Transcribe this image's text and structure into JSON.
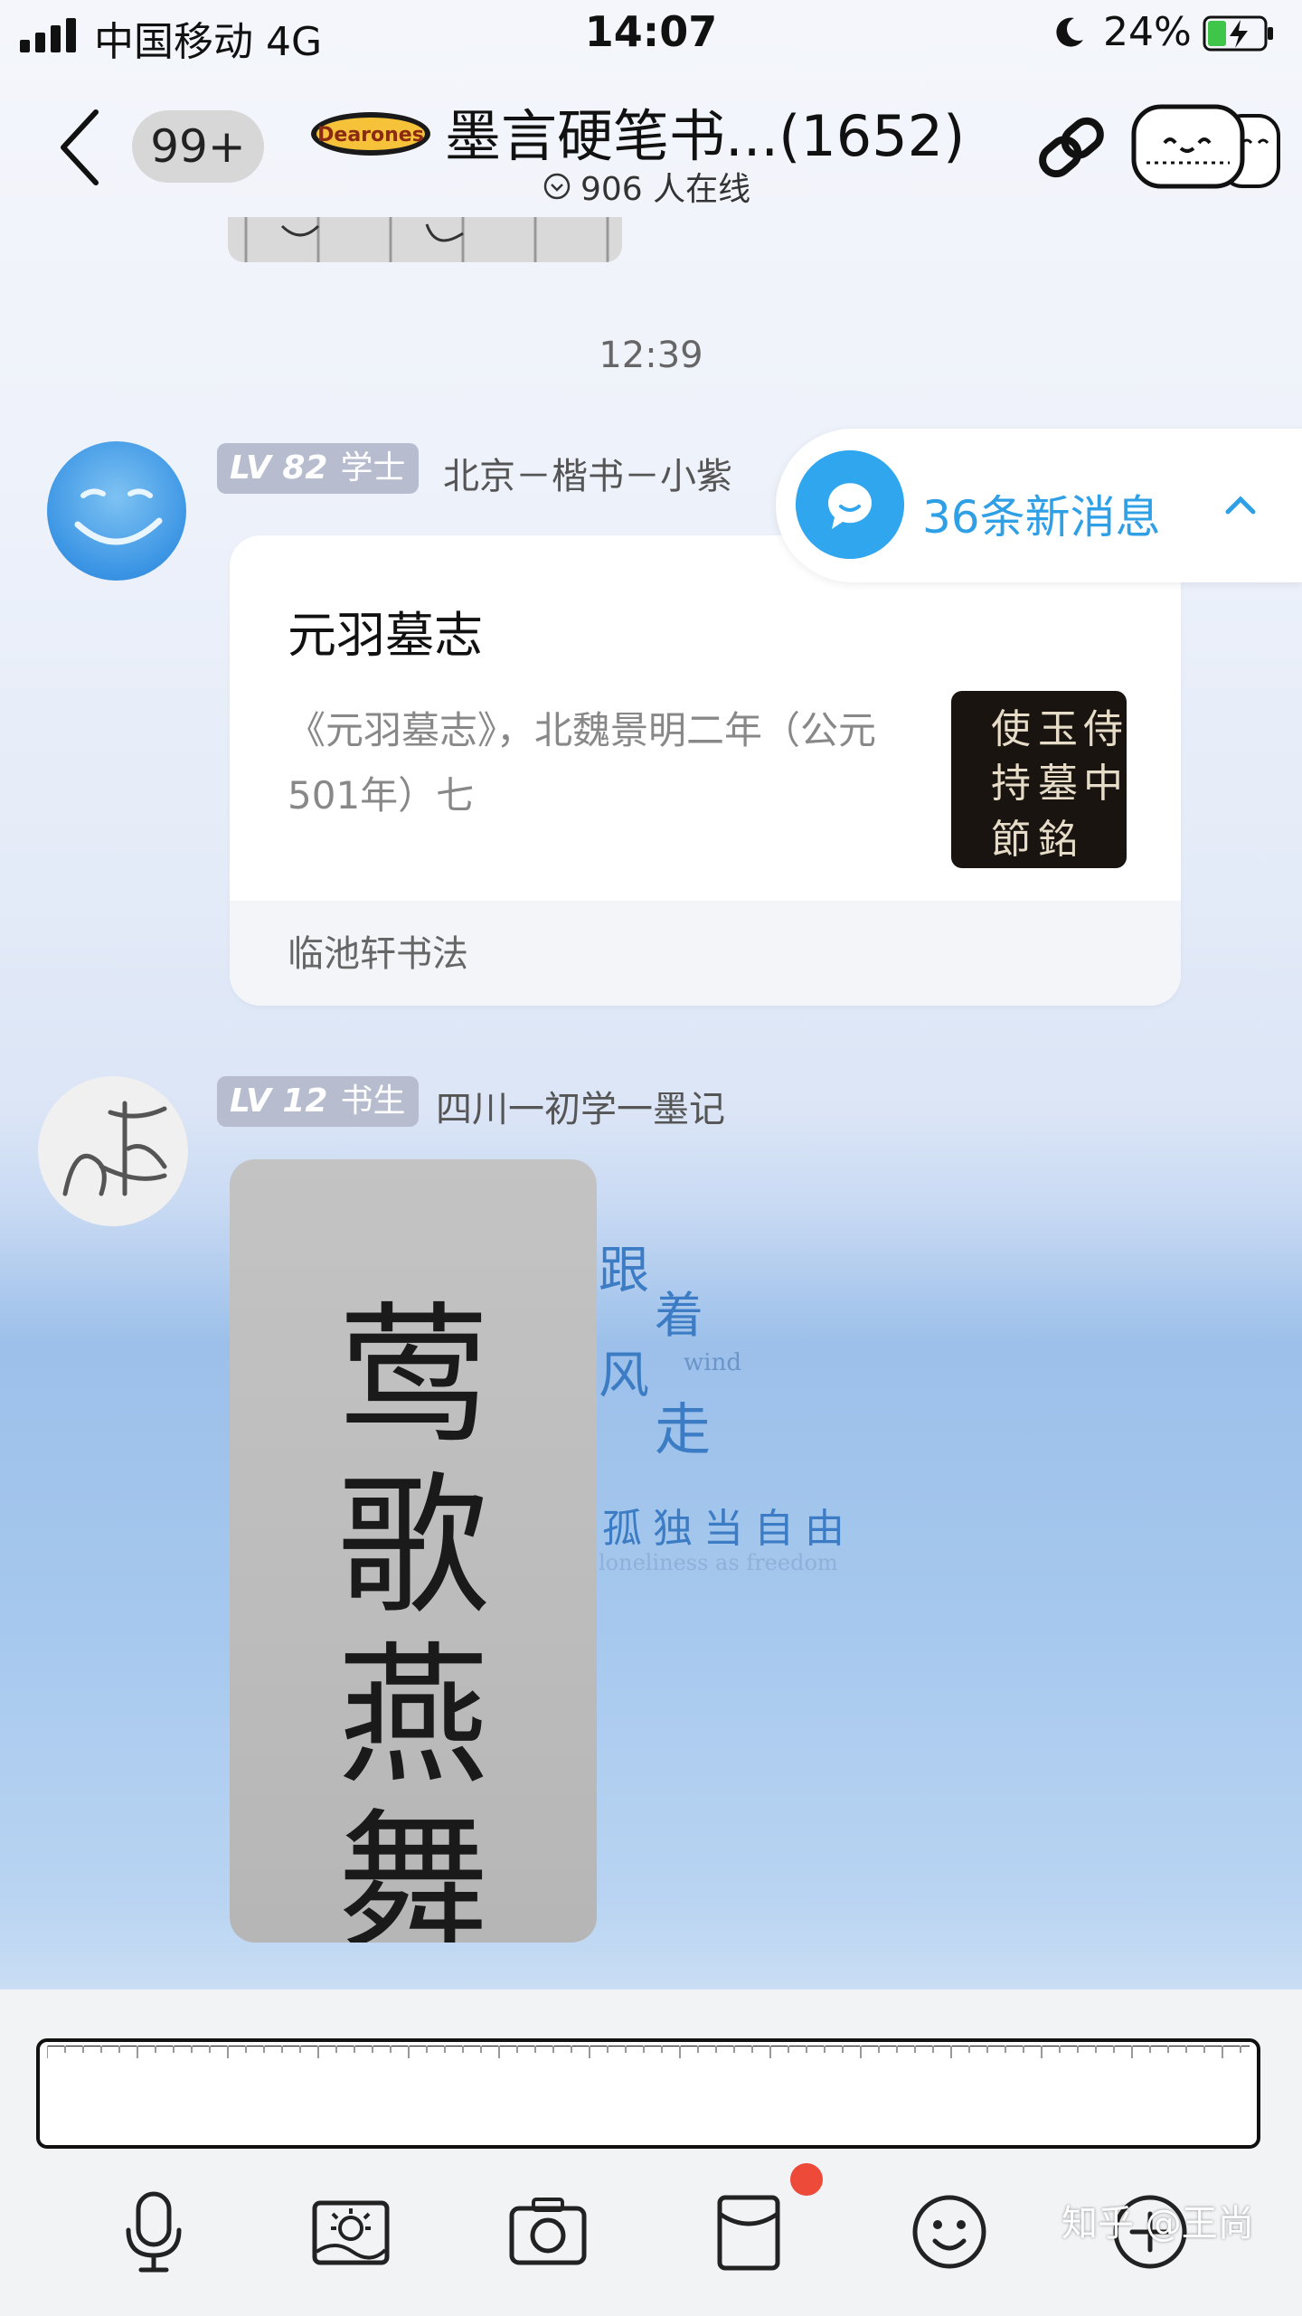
{
  "status_bar": {
    "carrier": "中国移动  4G",
    "time": "14:07",
    "battery": "24%"
  },
  "header": {
    "back_icon": "chevron-left-icon",
    "unread_count": "99+",
    "group_logo": "Dearones",
    "group_title": "墨言硬笔书...(1652)",
    "online_count": "906 人在线"
  },
  "chat": {
    "time_divider": "12:39",
    "messages": [
      {
        "level": "LV 82",
        "rank": "学士",
        "sender": "北京－楷书－小紫",
        "card": {
          "title": "元羽墓志",
          "description": "《元羽墓志》，北魏景明二年（公元501年）七",
          "source": "临池轩书法",
          "thumb_chars": [
            "侍",
            "玉",
            "使",
            "中",
            "墓",
            "持",
            "節",
            "銘"
          ]
        }
      },
      {
        "level": "LV 12",
        "rank": "书生",
        "sender": "四川一初学一墨记",
        "photo_chars": [
          "莺",
          "歌",
          "燕",
          "舞"
        ]
      }
    ],
    "background_text": [
      "跟",
      "着",
      "风",
      "wind",
      "走",
      "孤独当自由",
      "loneliness as freedom"
    ]
  },
  "new_messages": {
    "label": "36条新消息"
  },
  "input": {
    "placeholder": ""
  },
  "toolbar": {
    "icons": [
      "microphone-icon",
      "image-icon",
      "camera-icon",
      "red-packet-icon",
      "emoji-icon",
      "plus-icon"
    ]
  },
  "watermark": "知乎 @王尚"
}
